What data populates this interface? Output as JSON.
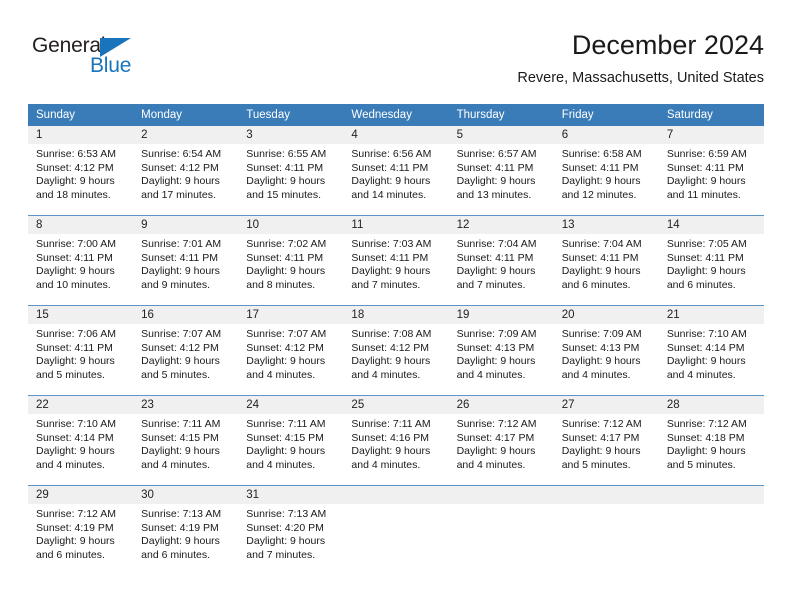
{
  "brand": {
    "name_part1": "General",
    "name_part2": "Blue"
  },
  "header": {
    "title": "December 2024",
    "location": "Revere, Massachusetts, United States"
  },
  "calendar": {
    "weekday_headers": [
      "Sunday",
      "Monday",
      "Tuesday",
      "Wednesday",
      "Thursday",
      "Friday",
      "Saturday"
    ],
    "colors": {
      "header_blue": "#3a7cb8",
      "daynum_band": "#f0f0f0",
      "brand_blue": "#1a74bb",
      "text": "#1a1a1a"
    },
    "weeks": [
      [
        {
          "day": "1",
          "sunrise": "Sunrise: 6:53 AM",
          "sunset": "Sunset: 4:12 PM",
          "daylight_line1": "Daylight: 9 hours",
          "daylight_line2": "and 18 minutes."
        },
        {
          "day": "2",
          "sunrise": "Sunrise: 6:54 AM",
          "sunset": "Sunset: 4:12 PM",
          "daylight_line1": "Daylight: 9 hours",
          "daylight_line2": "and 17 minutes."
        },
        {
          "day": "3",
          "sunrise": "Sunrise: 6:55 AM",
          "sunset": "Sunset: 4:11 PM",
          "daylight_line1": "Daylight: 9 hours",
          "daylight_line2": "and 15 minutes."
        },
        {
          "day": "4",
          "sunrise": "Sunrise: 6:56 AM",
          "sunset": "Sunset: 4:11 PM",
          "daylight_line1": "Daylight: 9 hours",
          "daylight_line2": "and 14 minutes."
        },
        {
          "day": "5",
          "sunrise": "Sunrise: 6:57 AM",
          "sunset": "Sunset: 4:11 PM",
          "daylight_line1": "Daylight: 9 hours",
          "daylight_line2": "and 13 minutes."
        },
        {
          "day": "6",
          "sunrise": "Sunrise: 6:58 AM",
          "sunset": "Sunset: 4:11 PM",
          "daylight_line1": "Daylight: 9 hours",
          "daylight_line2": "and 12 minutes."
        },
        {
          "day": "7",
          "sunrise": "Sunrise: 6:59 AM",
          "sunset": "Sunset: 4:11 PM",
          "daylight_line1": "Daylight: 9 hours",
          "daylight_line2": "and 11 minutes."
        }
      ],
      [
        {
          "day": "8",
          "sunrise": "Sunrise: 7:00 AM",
          "sunset": "Sunset: 4:11 PM",
          "daylight_line1": "Daylight: 9 hours",
          "daylight_line2": "and 10 minutes."
        },
        {
          "day": "9",
          "sunrise": "Sunrise: 7:01 AM",
          "sunset": "Sunset: 4:11 PM",
          "daylight_line1": "Daylight: 9 hours",
          "daylight_line2": "and 9 minutes."
        },
        {
          "day": "10",
          "sunrise": "Sunrise: 7:02 AM",
          "sunset": "Sunset: 4:11 PM",
          "daylight_line1": "Daylight: 9 hours",
          "daylight_line2": "and 8 minutes."
        },
        {
          "day": "11",
          "sunrise": "Sunrise: 7:03 AM",
          "sunset": "Sunset: 4:11 PM",
          "daylight_line1": "Daylight: 9 hours",
          "daylight_line2": "and 7 minutes."
        },
        {
          "day": "12",
          "sunrise": "Sunrise: 7:04 AM",
          "sunset": "Sunset: 4:11 PM",
          "daylight_line1": "Daylight: 9 hours",
          "daylight_line2": "and 7 minutes."
        },
        {
          "day": "13",
          "sunrise": "Sunrise: 7:04 AM",
          "sunset": "Sunset: 4:11 PM",
          "daylight_line1": "Daylight: 9 hours",
          "daylight_line2": "and 6 minutes."
        },
        {
          "day": "14",
          "sunrise": "Sunrise: 7:05 AM",
          "sunset": "Sunset: 4:11 PM",
          "daylight_line1": "Daylight: 9 hours",
          "daylight_line2": "and 6 minutes."
        }
      ],
      [
        {
          "day": "15",
          "sunrise": "Sunrise: 7:06 AM",
          "sunset": "Sunset: 4:11 PM",
          "daylight_line1": "Daylight: 9 hours",
          "daylight_line2": "and 5 minutes."
        },
        {
          "day": "16",
          "sunrise": "Sunrise: 7:07 AM",
          "sunset": "Sunset: 4:12 PM",
          "daylight_line1": "Daylight: 9 hours",
          "daylight_line2": "and 5 minutes."
        },
        {
          "day": "17",
          "sunrise": "Sunrise: 7:07 AM",
          "sunset": "Sunset: 4:12 PM",
          "daylight_line1": "Daylight: 9 hours",
          "daylight_line2": "and 4 minutes."
        },
        {
          "day": "18",
          "sunrise": "Sunrise: 7:08 AM",
          "sunset": "Sunset: 4:12 PM",
          "daylight_line1": "Daylight: 9 hours",
          "daylight_line2": "and 4 minutes."
        },
        {
          "day": "19",
          "sunrise": "Sunrise: 7:09 AM",
          "sunset": "Sunset: 4:13 PM",
          "daylight_line1": "Daylight: 9 hours",
          "daylight_line2": "and 4 minutes."
        },
        {
          "day": "20",
          "sunrise": "Sunrise: 7:09 AM",
          "sunset": "Sunset: 4:13 PM",
          "daylight_line1": "Daylight: 9 hours",
          "daylight_line2": "and 4 minutes."
        },
        {
          "day": "21",
          "sunrise": "Sunrise: 7:10 AM",
          "sunset": "Sunset: 4:14 PM",
          "daylight_line1": "Daylight: 9 hours",
          "daylight_line2": "and 4 minutes."
        }
      ],
      [
        {
          "day": "22",
          "sunrise": "Sunrise: 7:10 AM",
          "sunset": "Sunset: 4:14 PM",
          "daylight_line1": "Daylight: 9 hours",
          "daylight_line2": "and 4 minutes."
        },
        {
          "day": "23",
          "sunrise": "Sunrise: 7:11 AM",
          "sunset": "Sunset: 4:15 PM",
          "daylight_line1": "Daylight: 9 hours",
          "daylight_line2": "and 4 minutes."
        },
        {
          "day": "24",
          "sunrise": "Sunrise: 7:11 AM",
          "sunset": "Sunset: 4:15 PM",
          "daylight_line1": "Daylight: 9 hours",
          "daylight_line2": "and 4 minutes."
        },
        {
          "day": "25",
          "sunrise": "Sunrise: 7:11 AM",
          "sunset": "Sunset: 4:16 PM",
          "daylight_line1": "Daylight: 9 hours",
          "daylight_line2": "and 4 minutes."
        },
        {
          "day": "26",
          "sunrise": "Sunrise: 7:12 AM",
          "sunset": "Sunset: 4:17 PM",
          "daylight_line1": "Daylight: 9 hours",
          "daylight_line2": "and 4 minutes."
        },
        {
          "day": "27",
          "sunrise": "Sunrise: 7:12 AM",
          "sunset": "Sunset: 4:17 PM",
          "daylight_line1": "Daylight: 9 hours",
          "daylight_line2": "and 5 minutes."
        },
        {
          "day": "28",
          "sunrise": "Sunrise: 7:12 AM",
          "sunset": "Sunset: 4:18 PM",
          "daylight_line1": "Daylight: 9 hours",
          "daylight_line2": "and 5 minutes."
        }
      ],
      [
        {
          "day": "29",
          "sunrise": "Sunrise: 7:12 AM",
          "sunset": "Sunset: 4:19 PM",
          "daylight_line1": "Daylight: 9 hours",
          "daylight_line2": "and 6 minutes."
        },
        {
          "day": "30",
          "sunrise": "Sunrise: 7:13 AM",
          "sunset": "Sunset: 4:19 PM",
          "daylight_line1": "Daylight: 9 hours",
          "daylight_line2": "and 6 minutes."
        },
        {
          "day": "31",
          "sunrise": "Sunrise: 7:13 AM",
          "sunset": "Sunset: 4:20 PM",
          "daylight_line1": "Daylight: 9 hours",
          "daylight_line2": "and 7 minutes."
        },
        {
          "day": "",
          "sunrise": "",
          "sunset": "",
          "daylight_line1": "",
          "daylight_line2": ""
        },
        {
          "day": "",
          "sunrise": "",
          "sunset": "",
          "daylight_line1": "",
          "daylight_line2": ""
        },
        {
          "day": "",
          "sunrise": "",
          "sunset": "",
          "daylight_line1": "",
          "daylight_line2": ""
        },
        {
          "day": "",
          "sunrise": "",
          "sunset": "",
          "daylight_line1": "",
          "daylight_line2": ""
        }
      ]
    ]
  }
}
